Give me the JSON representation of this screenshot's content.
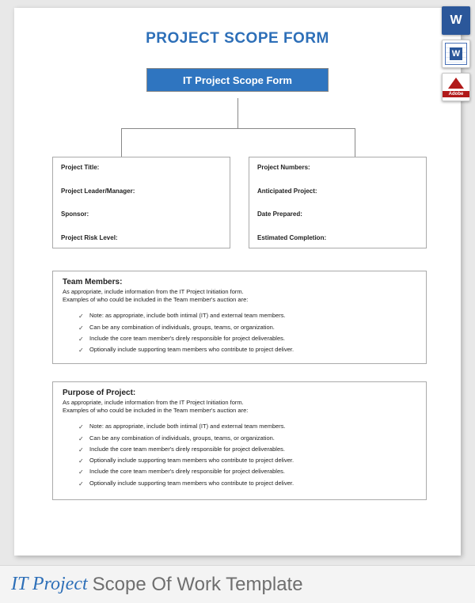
{
  "page_title": "PROJECT SCOPE FORM",
  "subtitle": "IT Project Scope Form",
  "left_box": {
    "f1": "Project Title:",
    "f2": "Project Leader/Manager:",
    "f3": "Sponsor:",
    "f4": "Project Risk Level:"
  },
  "right_box": {
    "f1": "Project Numbers:",
    "f2": "Anticipated Project:",
    "f3": "Date Prepared:",
    "f4": "Estimated Completion:"
  },
  "team": {
    "title": "Team Members:",
    "intro1": "As appropriate, include information from the IT Project Initiation form.",
    "intro2": "Examples of who could be included in the Team member's auction are:",
    "items": [
      "Note: as appropriate, include both intimal (IT) and external team members.",
      "Can be any combination of individuals, groups, teams, or organization.",
      "Include the core team member's direly responsible for project deliverables.",
      "Optionally include supporting team members who contribute to project deliver."
    ]
  },
  "purpose": {
    "title": "Purpose of Project:",
    "intro1": "As appropriate, include information from the IT Project Initiation form.",
    "intro2": "Examples of who could be included in the Team member's auction are:",
    "items": [
      "Note: as appropriate, include both intimal (IT) and external team members.",
      "Can be any combination of individuals, groups, teams, or organization.",
      "Include the core team member's direly responsible for project deliverables.",
      "Optionally include supporting team members who contribute to project deliver.",
      "Include the core team member's direly responsible for project deliverables.",
      "Optionally include supporting team members who contribute to project deliver."
    ]
  },
  "footer": {
    "strong": "IT Project",
    "rest": "Scope Of Work Template"
  },
  "icons": {
    "docx_label": "W",
    "doc_label": "W",
    "pdf_brand": "Adobe"
  }
}
